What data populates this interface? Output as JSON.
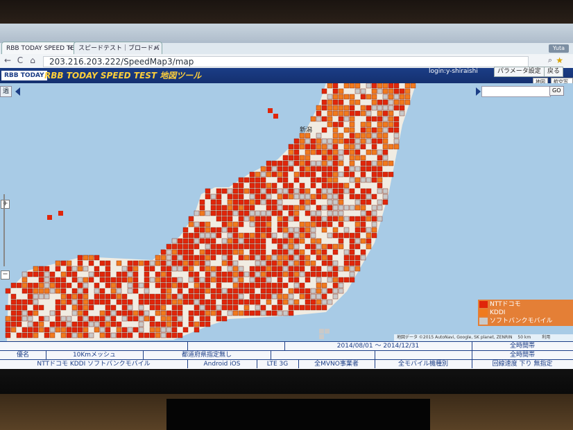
{
  "browser": {
    "tabs": [
      {
        "label": "RBB TODAY SPEED TE",
        "close": "×",
        "active": true
      },
      {
        "label": "スピードテスト｜ブロードバ",
        "close": "×",
        "active": false
      }
    ],
    "user": "Yuta",
    "url": "203.216.203.222/SpeedMap3/map",
    "back": "←",
    "reload": "C",
    "home": "⌂"
  },
  "app": {
    "logo": "RBB TODAY",
    "title": "RBB TODAY SPEED TEST 地図ツール",
    "login": "login:y-shiraishi",
    "param_button": "パラメータ設定",
    "back_button": "戻る",
    "map_button": "地図",
    "aerial_button": "航空写真"
  },
  "map": {
    "side_label": "過",
    "search_placeholder": "",
    "go_button": "GO",
    "city_niigata": "新潟",
    "legend": [
      {
        "label": "NTTドコモ",
        "color": "#e0260a"
      },
      {
        "label": "KDDI",
        "color": "#f07a1e"
      },
      {
        "label": "ソフトバンクモバイル",
        "color": "#c9c9c9"
      }
    ],
    "attribution": "地図データ ©2015 AutoNavi, Google, SK planet, ZENRIN",
    "scale": "50 km",
    "terms": "利用",
    "colors": {
      "docomo": "#e0260a",
      "kddi": "#f07a1e",
      "softbank": "#c9c9c9",
      "land": "#f1ece2",
      "sea": "#a8cbe6"
    }
  },
  "info": {
    "row1": [
      "",
      "",
      "",
      "2014/08/01 〜 2014/12/31",
      "",
      "全時間帯"
    ],
    "row2": [
      "優名",
      "10Kmメッシュ",
      "都道府県指定無し",
      "",
      "",
      "全時間帯"
    ],
    "row3": [
      "NTTドコモ KDDI ソフトバンクモバイル",
      "Android iOS",
      "LTE 3G",
      "全MVNO事業者",
      "全モバイル機種別",
      "回線速度 下り 無指定"
    ]
  }
}
